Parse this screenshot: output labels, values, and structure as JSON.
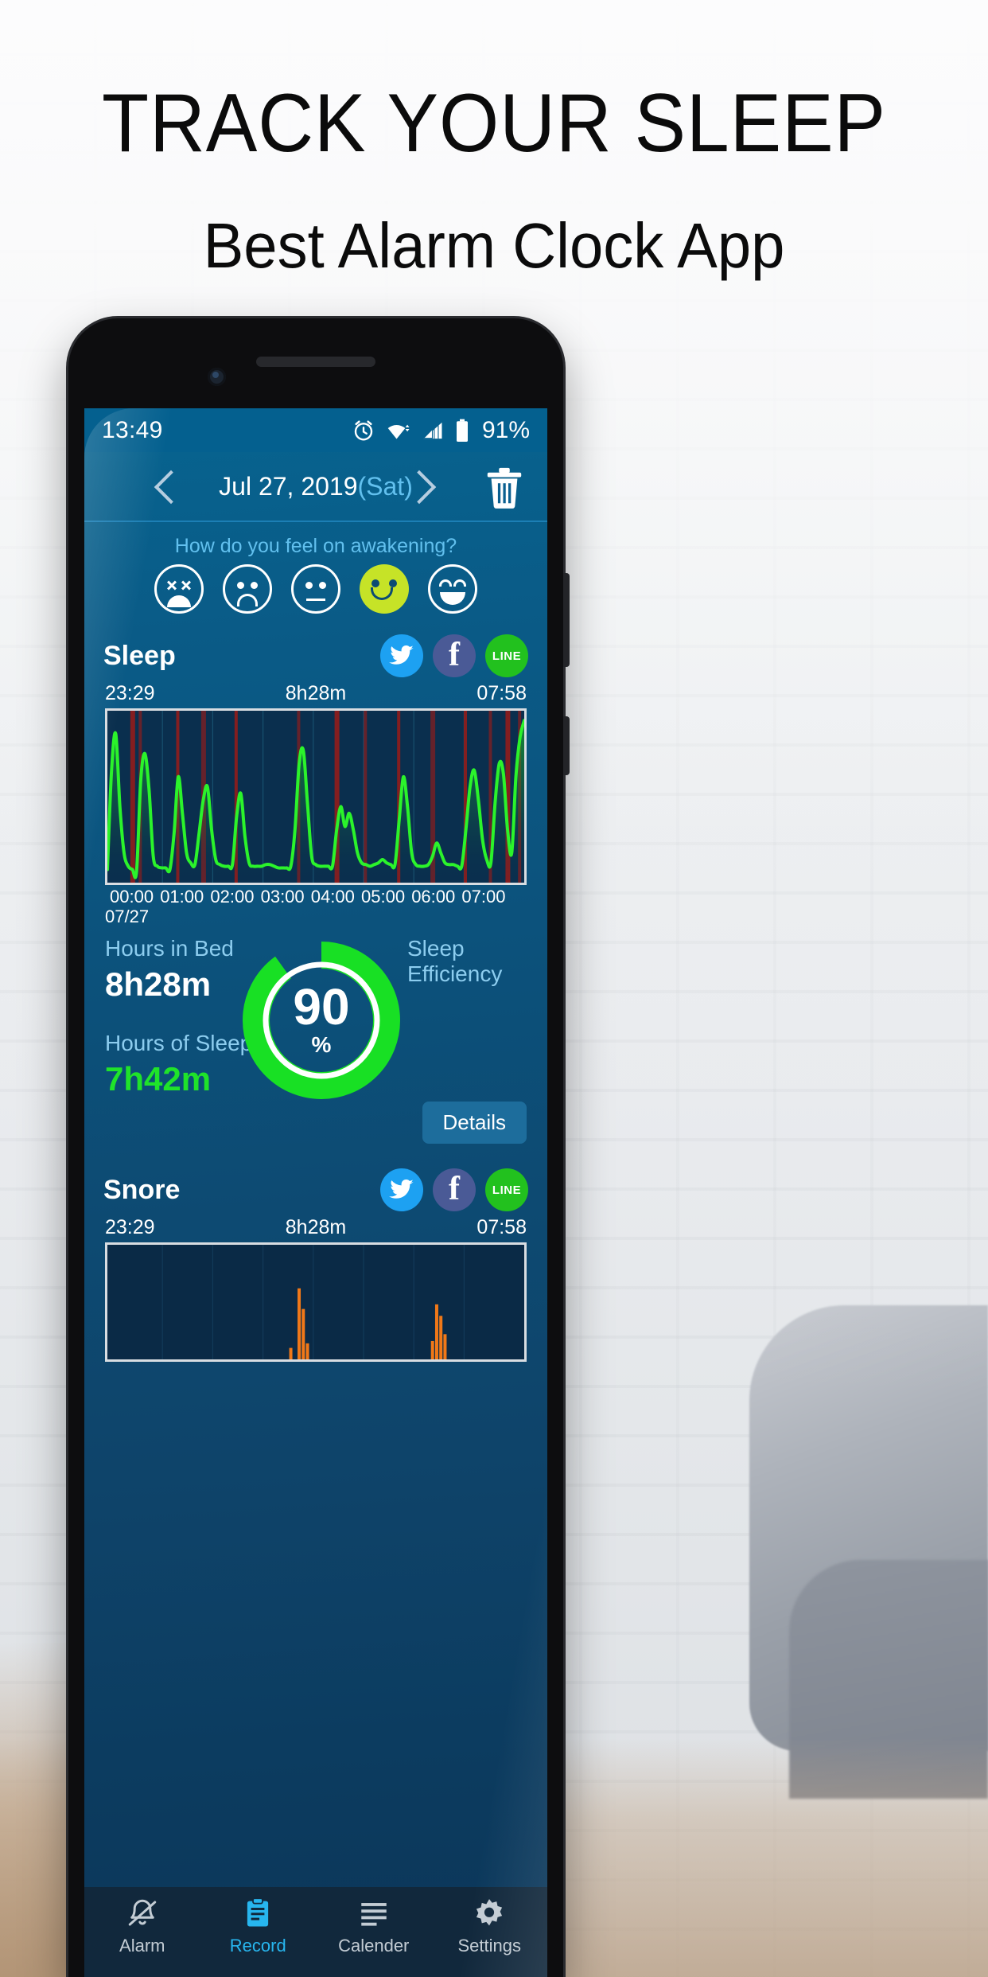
{
  "promo": {
    "headline": "TRACK YOUR SLEEP",
    "subheadline": "Best Alarm Clock App"
  },
  "status_bar": {
    "time": "13:49",
    "battery_percent": "91%",
    "icons": [
      "alarm-icon",
      "wifi-icon",
      "signal-icon",
      "battery-icon"
    ]
  },
  "date_bar": {
    "prev_icon": "chevron-left-icon",
    "next_icon": "chevron-right-icon",
    "date": "Jul 27, 2019",
    "day_of_week": "(Sat)",
    "delete_icon": "trash-icon"
  },
  "mood": {
    "question": "How do you feel on awakening?",
    "options": [
      {
        "name": "dead-face",
        "selected": false
      },
      {
        "name": "sad-face",
        "selected": false
      },
      {
        "name": "neutral-face",
        "selected": false
      },
      {
        "name": "happy-face",
        "selected": true
      },
      {
        "name": "laughing-face",
        "selected": false
      }
    ],
    "selected_index": 3,
    "selected_color": "#c6e327"
  },
  "sleep_section": {
    "title": "Sleep",
    "social": [
      {
        "name": "twitter",
        "label": "",
        "color": "#1da1f2"
      },
      {
        "name": "facebook",
        "label": "f",
        "color": "#4a5a96"
      },
      {
        "name": "line",
        "label": "LINE",
        "color": "#22c11e"
      }
    ],
    "start_time": "23:29",
    "duration": "8h28m",
    "end_time": "07:58",
    "x_ticks": [
      "00:00",
      "01:00",
      "02:00",
      "03:00",
      "04:00",
      "05:00",
      "06:00",
      "07:00"
    ],
    "x_date": "07/27"
  },
  "stats": {
    "hours_in_bed_label": "Hours in Bed",
    "hours_in_bed_value": "8h28m",
    "hours_of_sleep_label": "Hours of Sleep",
    "hours_of_sleep_value": "7h42m",
    "efficiency_label_line1": "Sleep",
    "efficiency_label_line2": "Efficiency",
    "efficiency_value": "90",
    "efficiency_unit": "%",
    "details_label": "Details",
    "sleep_color": "#1fe32a",
    "ring_color": "#18e024"
  },
  "snore_section": {
    "title": "Snore",
    "start_time": "23:29",
    "duration": "8h28m",
    "end_time": "07:58",
    "social": [
      {
        "name": "twitter",
        "label": "",
        "color": "#1da1f2"
      },
      {
        "name": "facebook",
        "label": "f",
        "color": "#4a5a96"
      },
      {
        "name": "line",
        "label": "LINE",
        "color": "#22c11e"
      }
    ]
  },
  "bottom_nav": {
    "items": [
      {
        "label": "Alarm",
        "icon": "bell-icon",
        "active": false
      },
      {
        "label": "Record",
        "icon": "clipboard-icon",
        "active": true
      },
      {
        "label": "Calender",
        "icon": "list-icon",
        "active": false
      },
      {
        "label": "Settings",
        "icon": "gear-icon",
        "active": false
      }
    ],
    "active_color": "#27b6ef"
  },
  "chart_data": {
    "type": "area",
    "title": "Sleep",
    "xlabel": "",
    "ylabel": "",
    "x_range": [
      "23:29",
      "07:58"
    ],
    "x_ticks": [
      "00:00",
      "01:00",
      "02:00",
      "03:00",
      "04:00",
      "05:00",
      "06:00",
      "07:00"
    ],
    "grid": true,
    "series": [
      {
        "name": "sleep-movement",
        "color": "#2bf32b",
        "x": [
          0,
          1,
          2,
          3,
          4,
          5,
          6,
          7,
          8,
          9,
          10,
          11,
          12,
          13,
          14,
          15,
          16,
          17,
          18,
          19,
          20,
          21,
          22,
          23,
          24,
          25,
          26,
          27,
          28,
          29,
          30,
          31,
          32,
          33,
          34,
          35,
          36,
          37,
          38,
          39,
          40,
          41,
          42,
          43,
          44,
          45,
          46,
          47,
          48,
          49,
          50,
          51,
          52,
          53,
          54,
          55,
          56,
          57,
          58,
          59,
          60,
          61,
          62,
          63,
          64,
          65,
          66,
          67,
          68,
          69,
          70,
          71,
          72,
          73,
          74,
          75,
          76,
          77,
          78,
          79,
          80,
          81,
          82,
          83,
          84,
          85,
          86,
          87,
          88,
          89,
          90,
          91,
          92,
          93,
          94,
          95,
          96,
          97,
          98,
          99,
          100
        ],
        "values": [
          6,
          66,
          88,
          44,
          16,
          8,
          6,
          5,
          60,
          76,
          54,
          14,
          8,
          7,
          7,
          6,
          28,
          62,
          40,
          16,
          10,
          9,
          28,
          48,
          56,
          30,
          12,
          9,
          8,
          8,
          9,
          38,
          52,
          26,
          10,
          8,
          8,
          8,
          9,
          9,
          8,
          7,
          7,
          7,
          8,
          30,
          70,
          78,
          46,
          14,
          9,
          8,
          8,
          8,
          8,
          30,
          44,
          32,
          40,
          30,
          16,
          10,
          9,
          8,
          9,
          10,
          12,
          10,
          9,
          9,
          36,
          62,
          44,
          16,
          9,
          8,
          8,
          9,
          14,
          22,
          16,
          10,
          9,
          9,
          8,
          8,
          30,
          56,
          66,
          48,
          24,
          12,
          10,
          46,
          70,
          64,
          30,
          16,
          62,
          86,
          96
        ]
      },
      {
        "name": "awake-markers",
        "color": "#8b1d1d",
        "positions": [
          6,
          8,
          17,
          23,
          31,
          46,
          55,
          62,
          70,
          78,
          86,
          92,
          96,
          99
        ]
      }
    ],
    "secondary_chart": {
      "type": "bar",
      "title": "Snore",
      "color": "#f07818",
      "x_range": [
        "23:29",
        "07:58"
      ],
      "positions": [
        44,
        46,
        47,
        48,
        78,
        79,
        80,
        81
      ],
      "values": [
        10,
        62,
        44,
        14,
        16,
        48,
        38,
        22
      ]
    }
  }
}
